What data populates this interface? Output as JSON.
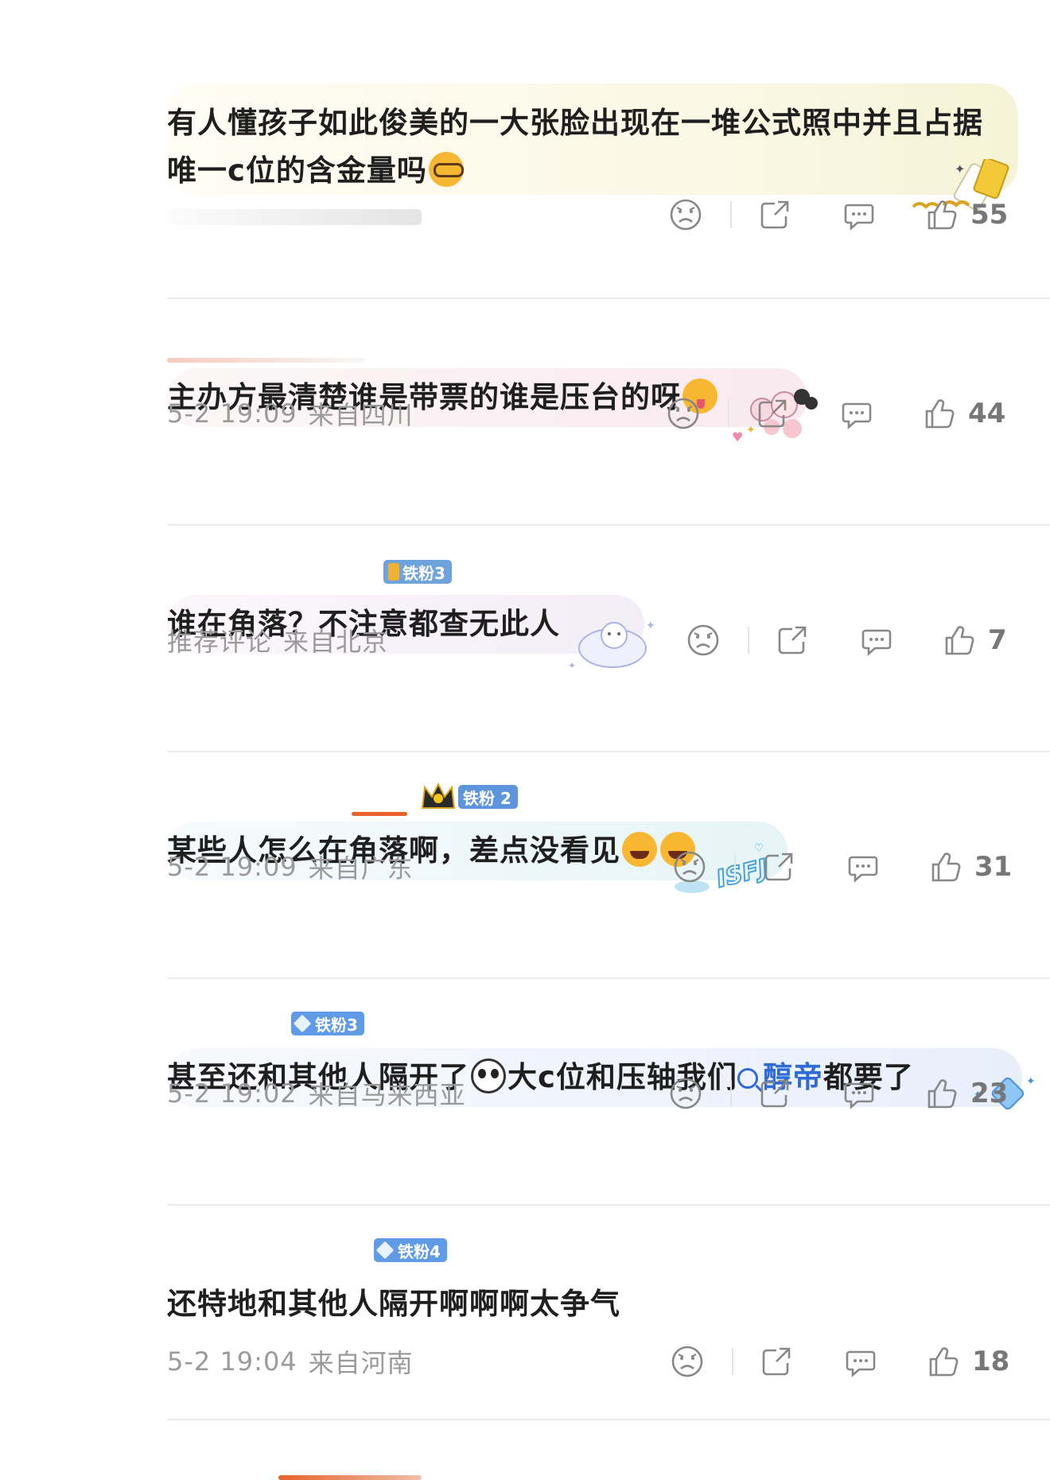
{
  "comments": [
    {
      "text": "有人懂孩子如此俊美的一大张脸出现在一堆公式照中并且占据唯一c位的含金量吗",
      "text_line1": "有人懂孩子如此俊美的一大张脸出现在一堆公式照中并且占据",
      "text_line2": "唯一c位的含金量吗",
      "emoji": "nerd-face-emoji",
      "time": "",
      "location": "",
      "likes": "55"
    },
    {
      "text": "主办方最清楚谁是带票的谁是压台的呀",
      "emoji": "winking-tongue-emoji",
      "time": "5-2 19:09",
      "location": "来自四川",
      "likes": "44"
    },
    {
      "badge": "铁粉3",
      "text": "谁在角落？不注意都查无此人",
      "time": "推荐评论",
      "location": "来自北京",
      "likes": "7"
    },
    {
      "badge": "铁粉 2",
      "text": "某些人怎么在角落啊，差点没看见",
      "emoji": "laughing-tears-emoji",
      "time": "5-2 19:09",
      "location": "来自广东",
      "likes": "31"
    },
    {
      "badge": "铁粉3",
      "text_part1": "甚至还和其他人隔开了",
      "text_part2": "大c位和压轴我们",
      "search_term": "醇帝",
      "text_part3": "都要了",
      "time": "5-2 19:02",
      "location": "来自马来西亚",
      "likes": "23"
    },
    {
      "badge": "铁粉4",
      "text": "还特地和其他人隔开啊啊啊太争气",
      "time": "5-2 19:04",
      "location": "来自河南",
      "likes": "18"
    }
  ],
  "colors": {
    "text": "#1f1f1f",
    "meta": "#9a9a9a",
    "badge": "#5a9ae6",
    "link": "#2f6bd6",
    "divider": "#ececec"
  }
}
